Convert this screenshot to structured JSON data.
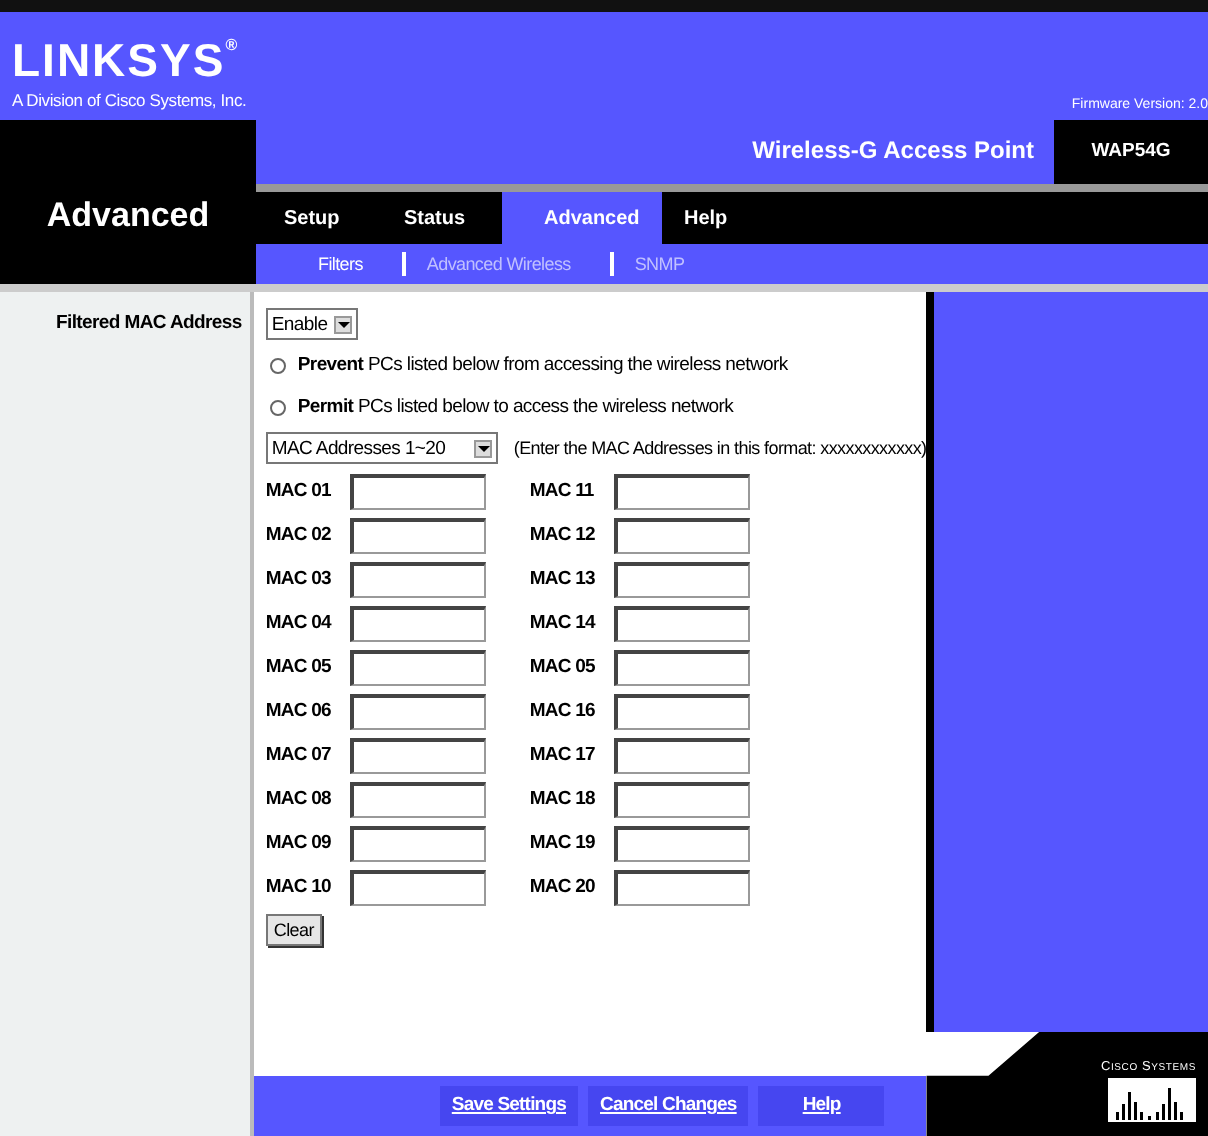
{
  "header": {
    "logo": "LINKSYS",
    "logo_mark": "®",
    "tagline": "A Division of Cisco Systems, Inc.",
    "firmware": "Firmware Version: 2.0"
  },
  "section_title": "Advanced",
  "product": "Wireless-G Access Point",
  "model": "WAP54G",
  "tabs": [
    {
      "label": "Setup",
      "selected": false
    },
    {
      "label": "Status",
      "selected": false
    },
    {
      "label": "Advanced",
      "selected": true
    },
    {
      "label": "Help",
      "selected": false
    }
  ],
  "subtabs": [
    {
      "label": "Filters",
      "selected": true
    },
    {
      "label": "Advanced Wireless",
      "selected": false
    },
    {
      "label": "SNMP",
      "selected": false
    }
  ],
  "form": {
    "label": "Filtered MAC Address",
    "filter_select": "Enable",
    "radios": [
      {
        "text": "**Prevent** PCs listed below from accessing the wireless network",
        "selected": false
      },
      {
        "text": "**Permit** PCs listed below to access the wireless network",
        "selected": false
      }
    ],
    "range_select": "MAC Addresses 1~20",
    "format_hint": "(Enter the MAC Addresses in this format: xxxxxxxxxxxx)",
    "mac_fields": [
      "MAC 01",
      "MAC 02",
      "MAC 03",
      "MAC 04",
      "MAC 05",
      "MAC 06",
      "MAC 07",
      "MAC 08",
      "MAC 09",
      "MAC 10",
      "MAC 11",
      "MAC 12",
      "MAC 13",
      "MAC 14",
      "MAC 05",
      "MAC 16",
      "MAC 17",
      "MAC 18",
      "MAC 19",
      "MAC 20"
    ],
    "clear_button": "Clear"
  },
  "footer_buttons": [
    "Save Settings",
    "Cancel Changes",
    "Help"
  ],
  "brand": "Cisco Systems"
}
